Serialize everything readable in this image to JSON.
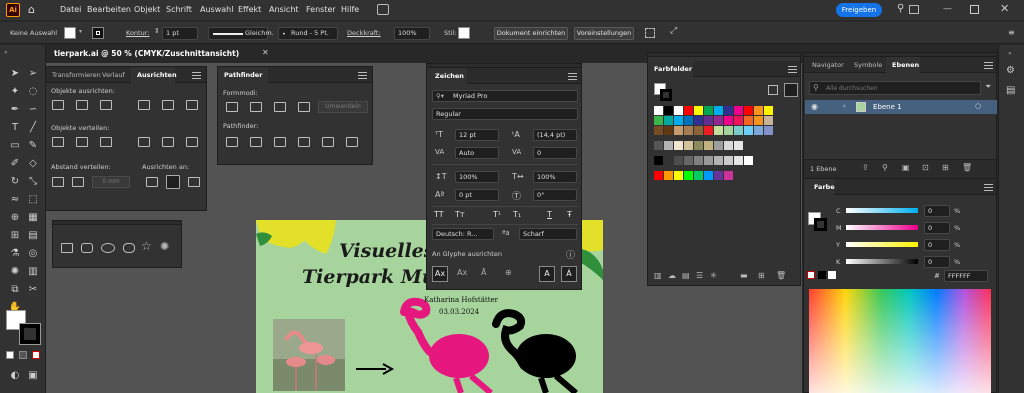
{
  "menubar": {
    "app_logo": "Ai",
    "items": [
      "Datei",
      "Bearbeiten",
      "Objekt",
      "Schrift",
      "Auswahl",
      "Effekt",
      "Ansicht",
      "Fenster",
      "Hilfe"
    ],
    "share_button": "Freigeben"
  },
  "controlbar": {
    "selection": "Keine Auswahl",
    "stroke_label": "Kontur:",
    "stroke_weight": "1 pt",
    "stroke_profile": "Gleichm.",
    "brush": "Rund - 5 Pt.",
    "opacity_label": "Deckkraft:",
    "opacity": "100%",
    "style_label": "Stil:",
    "doc_setup_button": "Dokument einrichten",
    "prefs_button": "Voreinstellungen"
  },
  "document": {
    "tab_title": "tierpark.ai @ 50 % (CMYK/Zuschnittansicht)"
  },
  "align_panel": {
    "tabs": [
      "Transformieren",
      "Verlauf",
      "Ausrichten"
    ],
    "align_objects_label": "Objekte ausrichten:",
    "distribute_objects_label": "Objekte verteilen:",
    "distribute_spacing_label": "Abstand verteilen:",
    "align_to_label": "Ausrichten an:",
    "spacing_value": "0 mm"
  },
  "pathfinder_panel": {
    "tab": "Pathfinder",
    "shape_modes_label": "Formmodi:",
    "pathfinder_label": "Pathfinder:",
    "expand_button": "Umwandeln"
  },
  "character_panel": {
    "tab": "Zeichen",
    "font_family": "Myriad Pro",
    "font_style": "Regular",
    "font_size": "12 pt",
    "leading": "(14,4 pt)",
    "kerning": "Auto",
    "tracking": "0",
    "vertical_scale": "100%",
    "horizontal_scale": "100%",
    "baseline_shift": "0 pt",
    "rotation": "0°",
    "language": "Deutsch: R...",
    "antialias": "Scharf",
    "snap_to_glyph_label": "An Glyphe ausrichten",
    "type_buttons": [
      "TT",
      "Tт",
      "T¹",
      "T₁",
      "T",
      "Ŧ"
    ]
  },
  "swatches_panel": {
    "tab": "Farbfelder"
  },
  "layers_panel": {
    "tabs": [
      "Navigator",
      "Symbole",
      "Ebenen"
    ],
    "search_placeholder": "Alle durchsuchen",
    "layer_name": "Ebene 1",
    "footer_count": "1 Ebene"
  },
  "color_panel": {
    "tab": "Farbe",
    "channels": [
      {
        "label": "C",
        "value": "0"
      },
      {
        "label": "M",
        "value": "0"
      },
      {
        "label": "Y",
        "value": "0"
      },
      {
        "label": "K",
        "value": "0"
      }
    ],
    "percent": "%",
    "hex_prefix": "#",
    "hex": "FFFFFF"
  },
  "artboard": {
    "title_line1": "Visuelles",
    "title_line2": "Tierpark Mu",
    "author": "Katharina Hofstätter",
    "date": "03.03.2024"
  },
  "colors": {
    "accent_blue": "#1473e6",
    "magenta": "#e6177e",
    "artboard_green": "#a6d49c",
    "yellow": "#e3e02a"
  }
}
